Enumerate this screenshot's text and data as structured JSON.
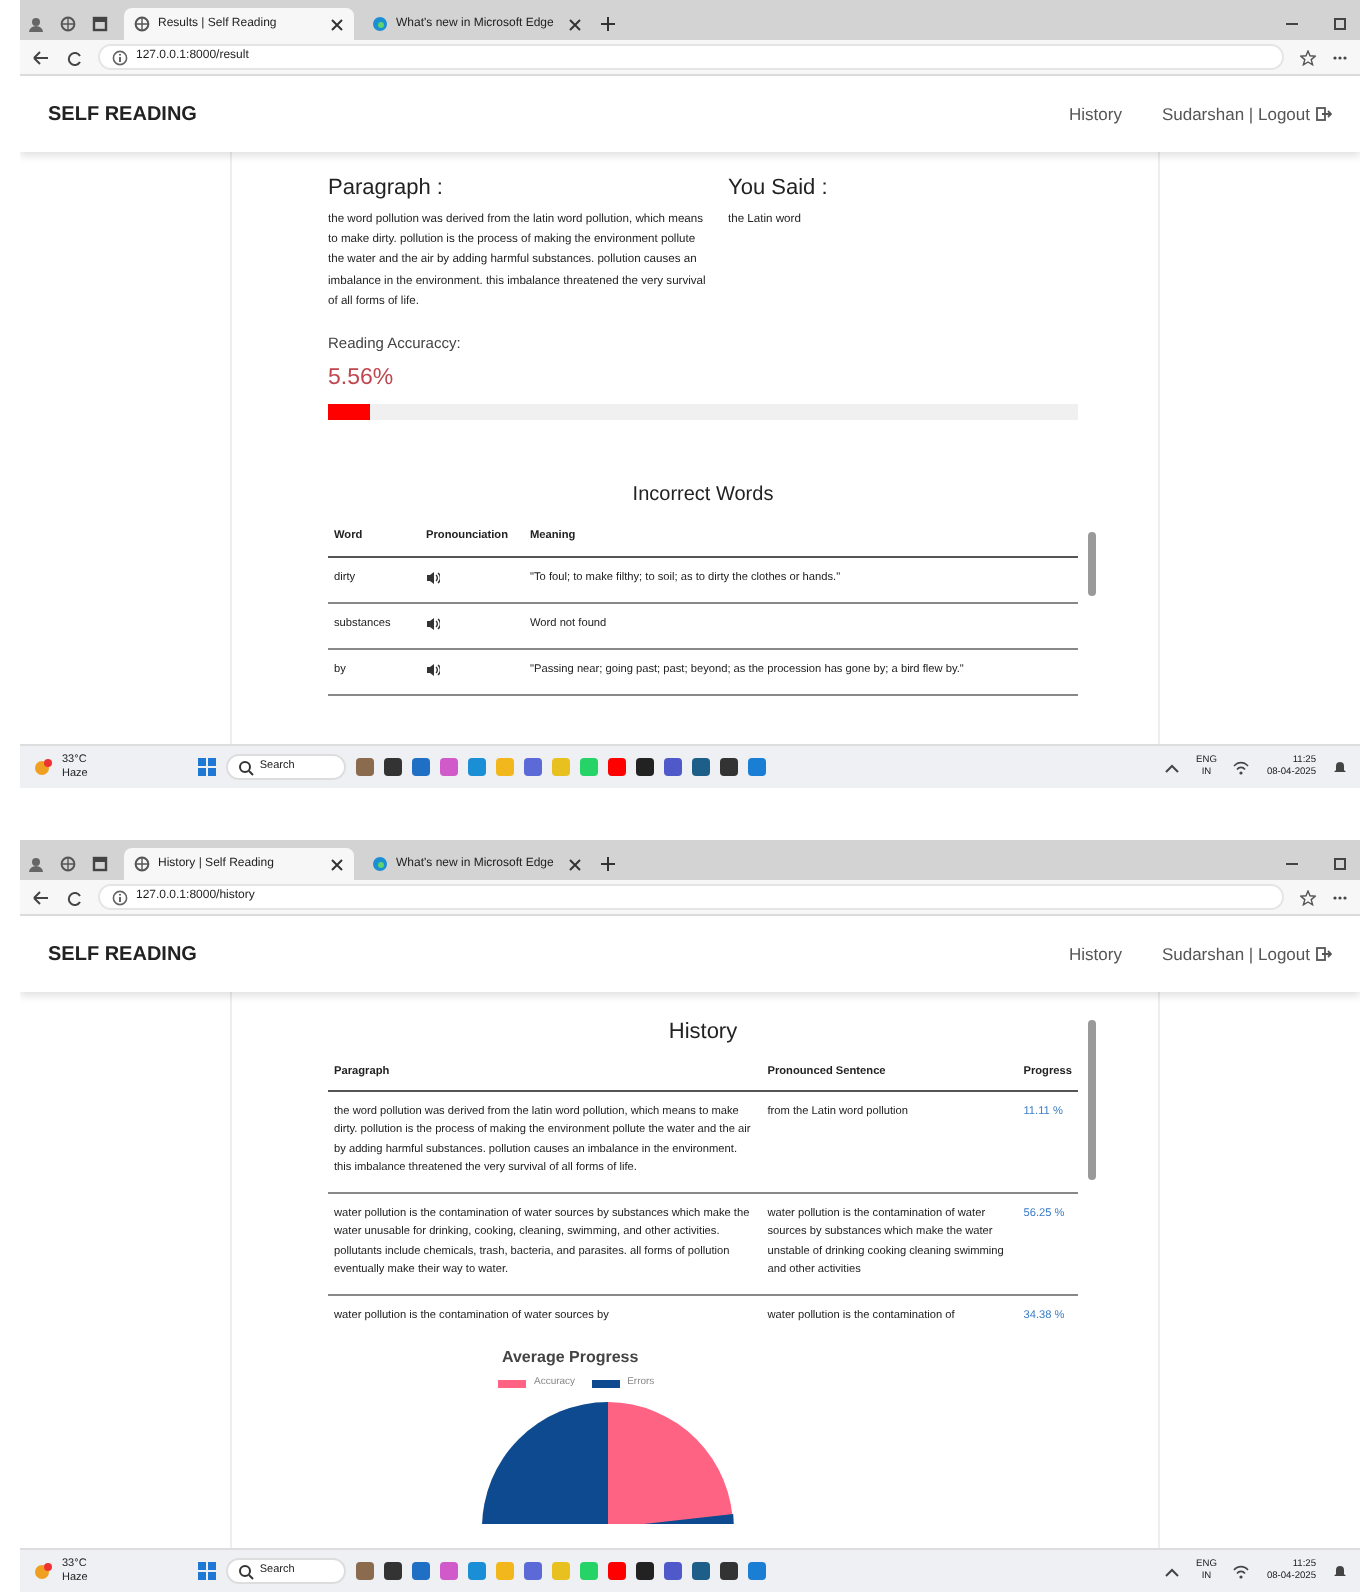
{
  "windows": [
    {
      "browser": {
        "tabs": [
          {
            "title": "Results | Self Reading",
            "selected": true
          },
          {
            "title": "What's new in Microsoft Edge",
            "selected": false
          }
        ],
        "url": "127.0.0.1:8000/result"
      },
      "navbar": {
        "brand": "SELF READING",
        "link": "History",
        "user": "Sudarshan | Logout"
      },
      "page": {
        "kind": "result",
        "paragraph_heading": "Paragraph :",
        "paragraph": "the word pollution was derived from the latin word pollution, which means to make dirty. pollution is the process of making the environment pollute the water and the air by adding harmful substances. pollution causes an imbalance in the environment. this imbalance threatened the very survival of all forms of life.",
        "you_said_heading": "You Said :",
        "you_said": "the Latin word",
        "accuracy_label": "Reading Accuraccy:",
        "accuracy_value": "5.56%",
        "accuracy": {
          "level": 0.0556
        },
        "table": {
          "title": "Incorrect Words",
          "columns": [
            "Word",
            "Pronounciation",
            "Meaning"
          ],
          "rows": [
            {
              "word": "dirty",
              "meaning": "\"To foul; to make filthy; to soil; as to dirty the clothes or hands.\""
            },
            {
              "word": "substances",
              "meaning": "Word not found"
            },
            {
              "word": "by",
              "meaning": "\"Passing near; going past; past; beyond; as the procession has gone by; a bird flew by.\""
            }
          ]
        }
      },
      "taskbar": {
        "temperature": "33°C",
        "weather": "Haze",
        "search": "Search",
        "language": "ENG",
        "region": "IN",
        "time": "11:25",
        "date": "08-04-2025"
      }
    },
    {
      "browser": {
        "tabs": [
          {
            "title": "History | Self Reading",
            "selected": true
          },
          {
            "title": "What's new in Microsoft Edge",
            "selected": false
          }
        ],
        "url": "127.0.0.1:8000/history"
      },
      "navbar": {
        "brand": "SELF READING",
        "link": "History",
        "user": "Sudarshan | Logout"
      },
      "page": {
        "kind": "history",
        "title": "History",
        "columns": [
          "Paragraph",
          "Pronounced Sentence",
          "Progress"
        ],
        "rows": [
          {
            "paragraph": "the word pollution was derived from the latin word pollution, which means to make dirty. pollution is the process of making the environment pollute the water and the air by adding harmful substances. pollution causes an imbalance in the environment. this imbalance threatened the very survival of all forms of life.",
            "pronounced": "from the Latin word pollution",
            "progress": "11.11 %"
          },
          {
            "paragraph": "water pollution is the contamination of water sources by substances which make the water unusable for drinking, cooking, cleaning, swimming, and other activities. pollutants include chemicals, trash, bacteria, and parasites. all forms of pollution eventually make their way to water.",
            "pronounced": "water pollution is the contamination of water sources by substances which make the water unstable of drinking cooking cleaning swimming and other activities",
            "progress": "56.25 %"
          },
          {
            "paragraph": "water pollution is the contamination of water sources by",
            "pronounced": "water pollution is the contamination of",
            "progress": "34.38 %"
          }
        ],
        "chart": {
          "title": "Average Progress",
          "legend": [
            {
              "label": "Accuracy",
              "color": "#ff6384"
            },
            {
              "label": "Errors",
              "color": "#0d4a8f"
            }
          ]
        }
      },
      "taskbar": {
        "temperature": "33°C",
        "weather": "Haze",
        "search": "Search",
        "language": "ENG",
        "region": "IN",
        "time": "11:25",
        "date": "08-04-2025"
      }
    }
  ]
}
